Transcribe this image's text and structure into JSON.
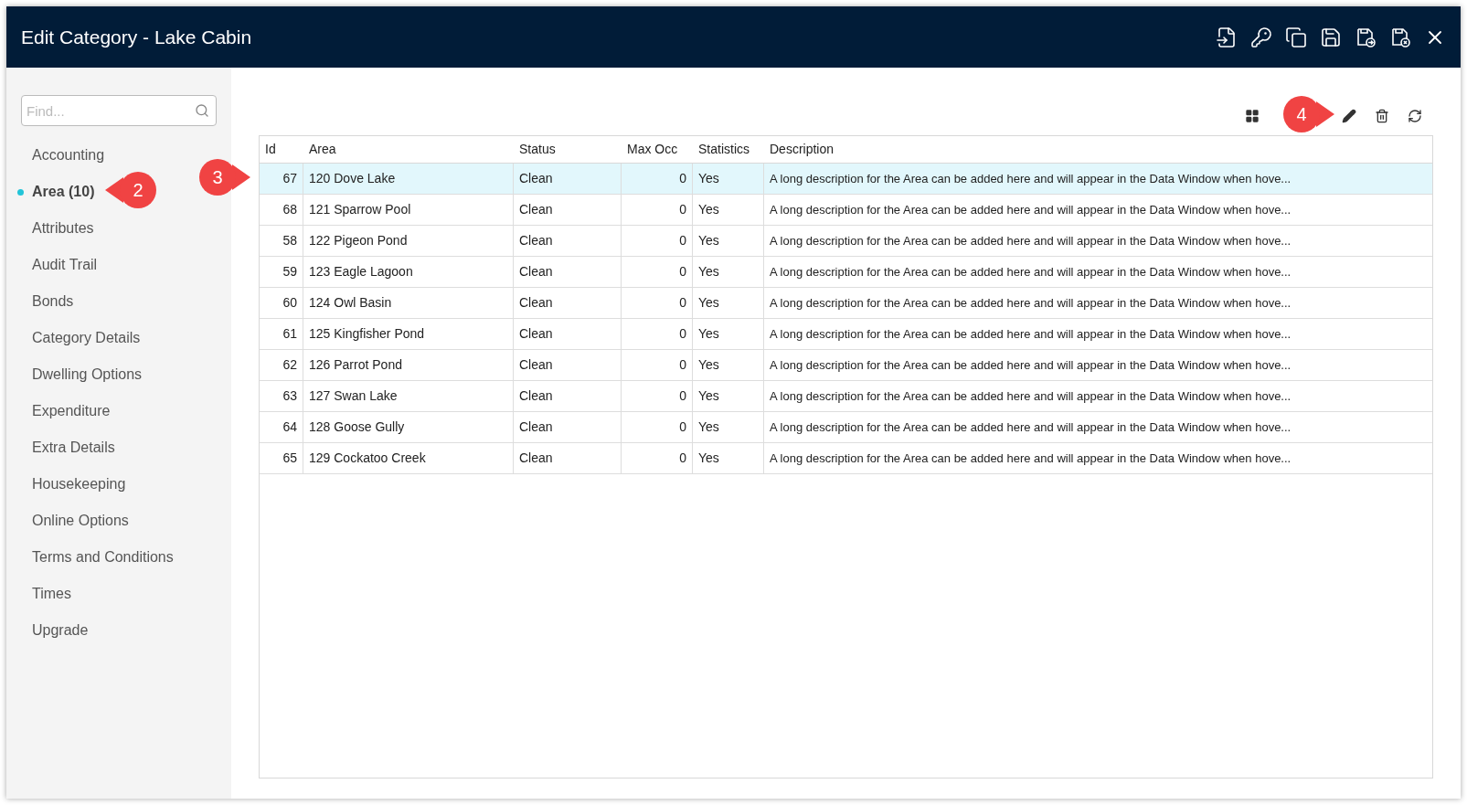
{
  "window": {
    "title": "Edit Category - Lake Cabin"
  },
  "search": {
    "placeholder": "Find..."
  },
  "sidebar": {
    "items": [
      {
        "label": "Accounting",
        "selected": false
      },
      {
        "label": "Area (10)",
        "selected": true
      },
      {
        "label": "Attributes",
        "selected": false
      },
      {
        "label": "Audit Trail",
        "selected": false
      },
      {
        "label": "Bonds",
        "selected": false
      },
      {
        "label": "Category Details",
        "selected": false
      },
      {
        "label": "Dwelling Options",
        "selected": false
      },
      {
        "label": "Expenditure",
        "selected": false
      },
      {
        "label": "Extra Details",
        "selected": false
      },
      {
        "label": "Housekeeping",
        "selected": false
      },
      {
        "label": "Online Options",
        "selected": false
      },
      {
        "label": "Terms and Conditions",
        "selected": false
      },
      {
        "label": "Times",
        "selected": false
      },
      {
        "label": "Upgrade",
        "selected": false
      }
    ]
  },
  "table": {
    "columns": [
      "Id",
      "Area",
      "Status",
      "Max Occ",
      "Statistics",
      "Description"
    ],
    "rows": [
      {
        "cells": [
          "67",
          "120 Dove Lake",
          "Clean",
          "0",
          "Yes",
          "A long description for the Area can be added here and will appear in the Data Window when hove..."
        ],
        "selected": true
      },
      {
        "cells": [
          "68",
          "121 Sparrow Pool",
          "Clean",
          "0",
          "Yes",
          "A long description for the Area can be added here and will appear in the Data Window when hove..."
        ],
        "selected": false
      },
      {
        "cells": [
          "58",
          "122 Pigeon Pond",
          "Clean",
          "0",
          "Yes",
          "A long description for the Area can be added here and will appear in the Data Window when hove..."
        ],
        "selected": false
      },
      {
        "cells": [
          "59",
          "123 Eagle Lagoon",
          "Clean",
          "0",
          "Yes",
          "A long description for the Area can be added here and will appear in the Data Window when hove..."
        ],
        "selected": false
      },
      {
        "cells": [
          "60",
          "124 Owl Basin",
          "Clean",
          "0",
          "Yes",
          "A long description for the Area can be added here and will appear in the Data Window when hove..."
        ],
        "selected": false
      },
      {
        "cells": [
          "61",
          "125 Kingfisher Pond",
          "Clean",
          "0",
          "Yes",
          "A long description for the Area can be added here and will appear in the Data Window when hove..."
        ],
        "selected": false
      },
      {
        "cells": [
          "62",
          "126 Parrot Pond",
          "Clean",
          "0",
          "Yes",
          "A long description for the Area can be added here and will appear in the Data Window when hove..."
        ],
        "selected": false
      },
      {
        "cells": [
          "63",
          "127 Swan Lake",
          "Clean",
          "0",
          "Yes",
          "A long description for the Area can be added here and will appear in the Data Window when hove..."
        ],
        "selected": false
      },
      {
        "cells": [
          "64",
          "128 Goose Gully",
          "Clean",
          "0",
          "Yes",
          "A long description for the Area can be added here and will appear in the Data Window when hove..."
        ],
        "selected": false
      },
      {
        "cells": [
          "65",
          "129 Cockatoo Creek",
          "Clean",
          "0",
          "Yes",
          "A long description for the Area can be added here and will appear in the Data Window when hove..."
        ],
        "selected": false
      }
    ]
  },
  "callouts": [
    {
      "label": "2"
    },
    {
      "label": "3"
    },
    {
      "label": "4"
    }
  ]
}
